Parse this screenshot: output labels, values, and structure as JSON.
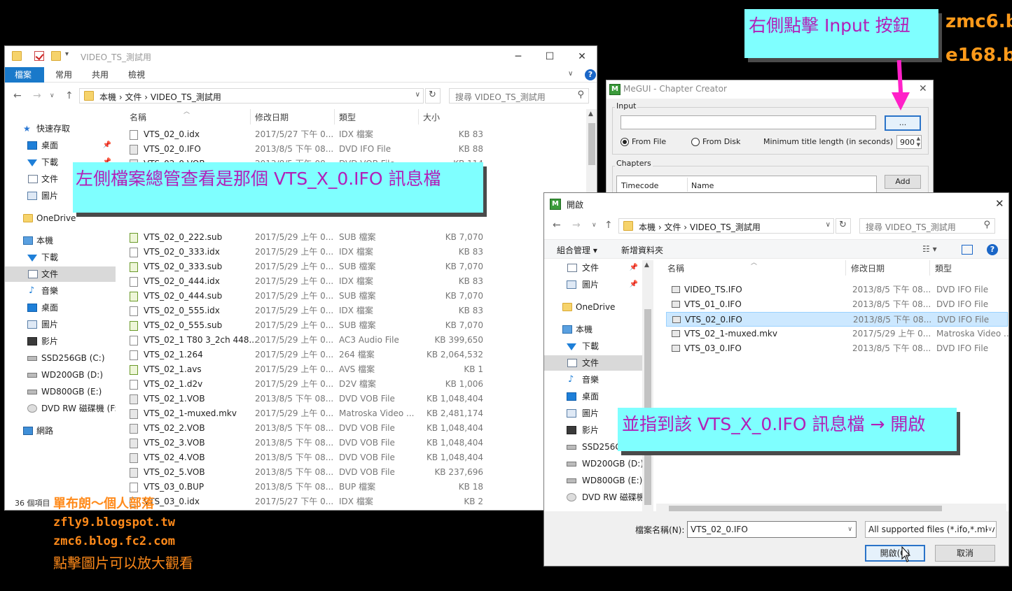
{
  "explorer": {
    "title": "VIDEO_TS_測試用",
    "ribbon_tabs": [
      "檔案",
      "常用",
      "共用",
      "檢視"
    ],
    "breadcrumb": "本機  ›  文件  ›  VIDEO_TS_測試用",
    "search_placeholder": "搜尋 VIDEO_TS_測試用",
    "columns": {
      "name": "名稱",
      "date": "修改日期",
      "type": "類型",
      "size": "大小"
    },
    "sidebar": [
      "快速存取",
      "桌面",
      "下載",
      "文件",
      "圖片",
      "OneDrive",
      "本機",
      "下載",
      "文件",
      "音樂",
      "桌面",
      "圖片",
      "影片",
      "SSD256GB (C:)",
      "WD200GB (D:)",
      "WD800GB (E:)",
      "DVD RW 磁碟機 (F:",
      "網路"
    ],
    "files": [
      {
        "name": "VTS_02_0.idx",
        "date": "2017/5/27 下午 0...",
        "type": "IDX 檔案",
        "size": "83 KB"
      },
      {
        "name": "VTS_02_0.IFO",
        "date": "2013/8/5 下午 08...",
        "type": "DVD IFO File",
        "size": "88 KB"
      },
      {
        "name": "VTS_02_0.VOB",
        "date": "2013/8/5 下午 08...",
        "type": "DVD VOB File",
        "size": "114 KB"
      },
      {
        "name": "VTS_02_0_222.sub",
        "date": "2017/5/29 上午 0...",
        "type": "SUB 檔案",
        "size": "7,070 KB"
      },
      {
        "name": "VTS_02_0_333.idx",
        "date": "2017/5/29 上午 0...",
        "type": "IDX 檔案",
        "size": "83 KB"
      },
      {
        "name": "VTS_02_0_333.sub",
        "date": "2017/5/29 上午 0...",
        "type": "SUB 檔案",
        "size": "7,070 KB"
      },
      {
        "name": "VTS_02_0_444.idx",
        "date": "2017/5/29 上午 0...",
        "type": "IDX 檔案",
        "size": "83 KB"
      },
      {
        "name": "VTS_02_0_444.sub",
        "date": "2017/5/29 上午 0...",
        "type": "SUB 檔案",
        "size": "7,070 KB"
      },
      {
        "name": "VTS_02_0_555.idx",
        "date": "2017/5/29 上午 0...",
        "type": "IDX 檔案",
        "size": "83 KB"
      },
      {
        "name": "VTS_02_0_555.sub",
        "date": "2017/5/29 上午 0...",
        "type": "SUB 檔案",
        "size": "7,070 KB"
      },
      {
        "name": "VTS_02_1 T80 3_2ch 448...",
        "date": "2017/5/29 上午 0...",
        "type": "AC3 Audio File",
        "size": "399,650 KB"
      },
      {
        "name": "VTS_02_1.264",
        "date": "2017/5/29 上午 0...",
        "type": "264 檔案",
        "size": "2,064,532 KB"
      },
      {
        "name": "VTS_02_1.avs",
        "date": "2017/5/29 上午 0...",
        "type": "AVS 檔案",
        "size": "1 KB"
      },
      {
        "name": "VTS_02_1.d2v",
        "date": "2017/5/29 上午 0...",
        "type": "D2V 檔案",
        "size": "1,006 KB"
      },
      {
        "name": "VTS_02_1.VOB",
        "date": "2013/8/5 下午 08...",
        "type": "DVD VOB File",
        "size": "1,048,404 KB"
      },
      {
        "name": "VTS_02_1-muxed.mkv",
        "date": "2017/5/29 上午 0...",
        "type": "Matroska Video ...",
        "size": "2,481,174 KB"
      },
      {
        "name": "VTS_02_2.VOB",
        "date": "2013/8/5 下午 08...",
        "type": "DVD VOB File",
        "size": "1,048,404 KB"
      },
      {
        "name": "VTS_02_3.VOB",
        "date": "2013/8/5 下午 08...",
        "type": "DVD VOB File",
        "size": "1,048,404 KB"
      },
      {
        "name": "VTS_02_4.VOB",
        "date": "2013/8/5 下午 08...",
        "type": "DVD VOB File",
        "size": "1,048,404 KB"
      },
      {
        "name": "VTS_02_5.VOB",
        "date": "2013/8/5 下午 08...",
        "type": "DVD VOB File",
        "size": "237,696 KB"
      },
      {
        "name": "VTS_03_0.BUP",
        "date": "2013/8/5 下午 08...",
        "type": "BUP 檔案",
        "size": "18 KB"
      },
      {
        "name": "VTS_03_0.idx",
        "date": "2017/5/27 下午 0...",
        "type": "IDX 檔案",
        "size": "2 KB"
      }
    ],
    "status": "36 個項目"
  },
  "megui": {
    "title": "MeGUI - Chapter Creator",
    "input_label": "Input",
    "browse_label": "...",
    "from_file": "From File",
    "from_disk": "From Disk",
    "min_title_label": "Minimum title length (in seconds)",
    "min_title_value": "900",
    "chapters_label": "Chapters",
    "col_timecode": "Timecode",
    "col_name": "Name",
    "add_label": "Add"
  },
  "open_dialog": {
    "title": "開啟",
    "breadcrumb": "本機  ›  文件  ›  VIDEO_TS_測試用",
    "search_placeholder": "搜尋 VIDEO_TS_測試用",
    "organize": "組合管理 ▾",
    "new_folder": "新增資料夾",
    "columns": {
      "name": "名稱",
      "date": "修改日期",
      "type": "類型"
    },
    "sidebar": [
      "文件",
      "圖片",
      "OneDrive",
      "本機",
      "下載",
      "文件",
      "音樂",
      "桌面",
      "圖片",
      "影片",
      "SSD256GB",
      "WD200GB (D:)",
      "WD800GB (E:)",
      "DVD RW 磁碟機"
    ],
    "files": [
      {
        "name": "VIDEO_TS.IFO",
        "date": "2013/8/5 下午 08...",
        "type": "DVD IFO File"
      },
      {
        "name": "VTS_01_0.IFO",
        "date": "2013/8/5 下午 08...",
        "type": "DVD IFO File"
      },
      {
        "name": "VTS_02_0.IFO",
        "date": "2013/8/5 下午 08...",
        "type": "DVD IFO File"
      },
      {
        "name": "VTS_02_1-muxed.mkv",
        "date": "2017/5/29 上午 0...",
        "type": "Matroska Video ..."
      },
      {
        "name": "VTS_03_0.IFO",
        "date": "2013/8/5 下午 08...",
        "type": "DVD IFO File"
      }
    ],
    "filename_label": "檔案名稱(N):",
    "filename_value": "VTS_02_0.IFO",
    "filetype_value": "All supported files (*.ifo,*.mkv",
    "open_label": "開啟(O)",
    "cancel_label": "取消"
  },
  "annotations": {
    "top_right": "右側點擊 Input 按鈕",
    "left_callout": "左側檔案總管查看是那個 VTS_X_0.IFO 訊息檔",
    "right_callout": "並指到該 VTS_X_0.IFO 訊息檔 → 開啟",
    "corner_1": "zmc6.b",
    "corner_2": "e168.b"
  },
  "footer": {
    "line1": "單布朗～個人部落",
    "line2": "zfly9.blogspot.tw",
    "line3": "zmc6.blog.fc2.com",
    "line4": "點擊圖片可以放大觀看"
  },
  "colors": {
    "callout_bg": "#7fffff",
    "callout_text": "#b21fb8",
    "arrow": "#ff20c8",
    "footer": "#ff8a1a"
  }
}
